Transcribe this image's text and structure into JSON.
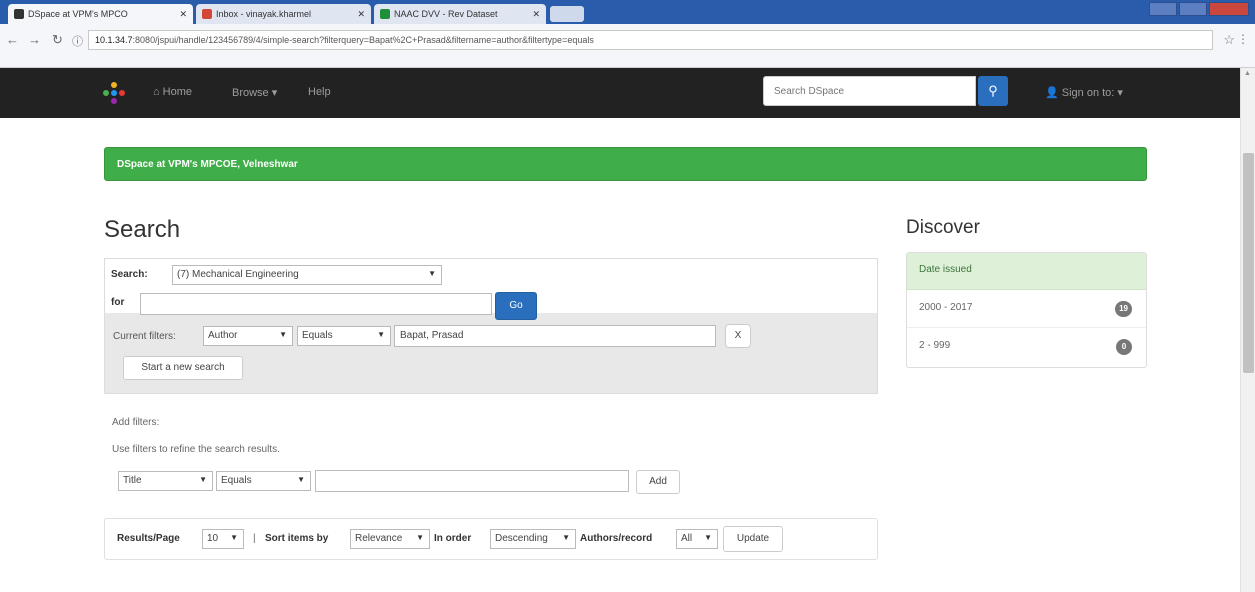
{
  "browser": {
    "tabs": [
      {
        "title": "DSpace at VPM's MPCO"
      },
      {
        "title": "Inbox - vinayak.kharmel"
      },
      {
        "title": "NAAC DVV - Rev Dataset"
      }
    ],
    "url_host": "10.1.34.7",
    "url_rest": ":8080/jspui/handle/123456789/4/simple-search?filterquery=Bapat%2C+Prasad&filtername=author&filtertype=equals"
  },
  "navbar": {
    "home": "Home",
    "browse": "Browse ▾",
    "help": "Help",
    "search_placeholder": "Search DSpace",
    "signin": "Sign on to: ▾"
  },
  "banner": {
    "text": "DSpace at VPM's MPCOE, Velneshwar"
  },
  "search": {
    "title": "Search",
    "search_label": "Search:",
    "scope_value": "(7) Mechanical Engineering",
    "for_label": "for",
    "query_value": "",
    "go_label": "Go",
    "current_filters_label": "Current filters:",
    "filter_field": "Author",
    "filter_op": "Equals",
    "filter_value": "Bapat, Prasad",
    "remove_label": "X",
    "start_new_label": "Start a new search"
  },
  "add_filters": {
    "heading": "Add filters:",
    "hint": "Use filters to refine the search results.",
    "field": "Title",
    "op": "Equals",
    "value": "",
    "add_label": "Add"
  },
  "results": {
    "per_page_label": "Results/Page",
    "per_page": "10",
    "sep": "|",
    "sort_label": "Sort items by",
    "sort_value": "Relevance",
    "order_label": "In order",
    "order_value": "Descending",
    "authors_label": "Authors/record",
    "authors_value": "All",
    "update_label": "Update"
  },
  "discover": {
    "title": "Discover",
    "facet_head": "Date issued",
    "items": [
      {
        "label": "2000 - 2017",
        "count": "19"
      },
      {
        "label": "2 - 999",
        "count": "0"
      }
    ]
  },
  "colors": {
    "navbar": "#222222",
    "banner": "#3fae49",
    "primary_button": "#2a6fbd",
    "facet_header": "#dff0d8"
  }
}
